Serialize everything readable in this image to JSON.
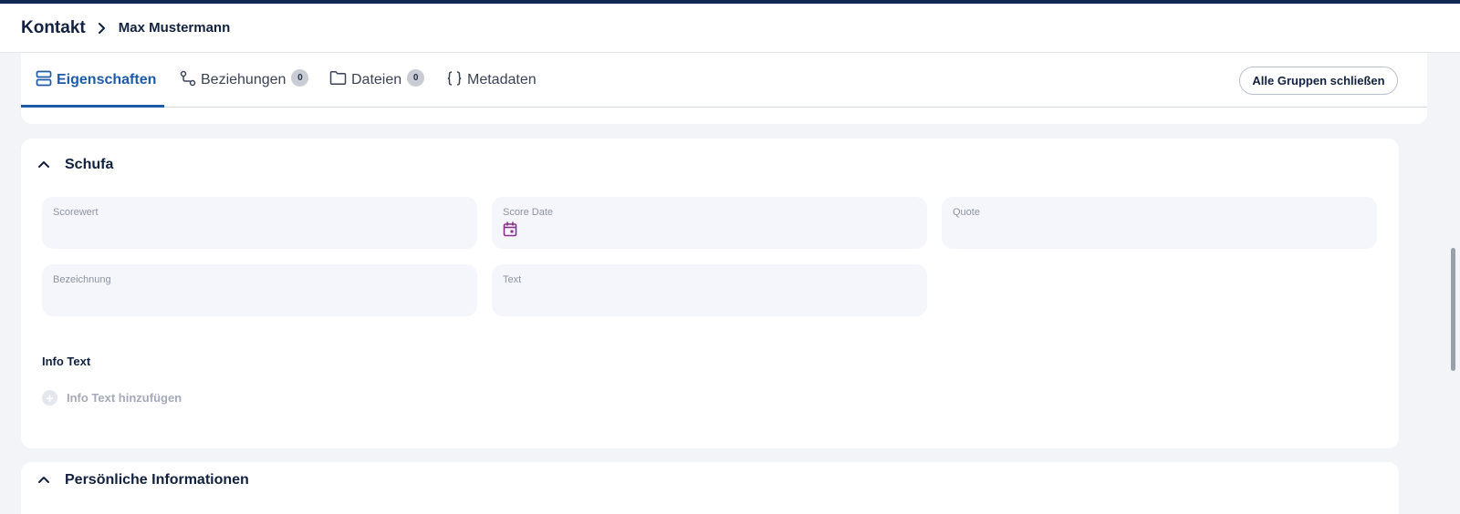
{
  "breadcrumb": {
    "root": "Kontakt",
    "current": "Max Mustermann"
  },
  "tabs": [
    {
      "label": "Eigenschaften",
      "icon": "stack-icon",
      "active": true
    },
    {
      "label": "Beziehungen",
      "icon": "relation-icon",
      "badge": "0"
    },
    {
      "label": "Dateien",
      "icon": "folder-icon",
      "badge": "0"
    },
    {
      "label": "Metadaten",
      "icon": "braces-icon"
    }
  ],
  "actions": {
    "collapse_all": "Alle Gruppen schließen"
  },
  "groups": [
    {
      "title": "Schufa",
      "expanded": true,
      "fields": [
        {
          "label": "Scorewert",
          "value": ""
        },
        {
          "label": "Score Date",
          "value": "",
          "icon": "calendar-icon"
        },
        {
          "label": "Quote",
          "value": ""
        },
        {
          "label": "Bezeichnung",
          "value": ""
        },
        {
          "label": "Text",
          "value": ""
        }
      ],
      "info_text": {
        "title": "Info Text",
        "add_label": "Info Text hinzufügen"
      }
    },
    {
      "title": "Persönliche Informationen",
      "expanded": true
    }
  ],
  "colors": {
    "accent": "#1d5ba8",
    "header_stripe": "#0f2a52",
    "calendar_icon": "#8a2f8a"
  }
}
